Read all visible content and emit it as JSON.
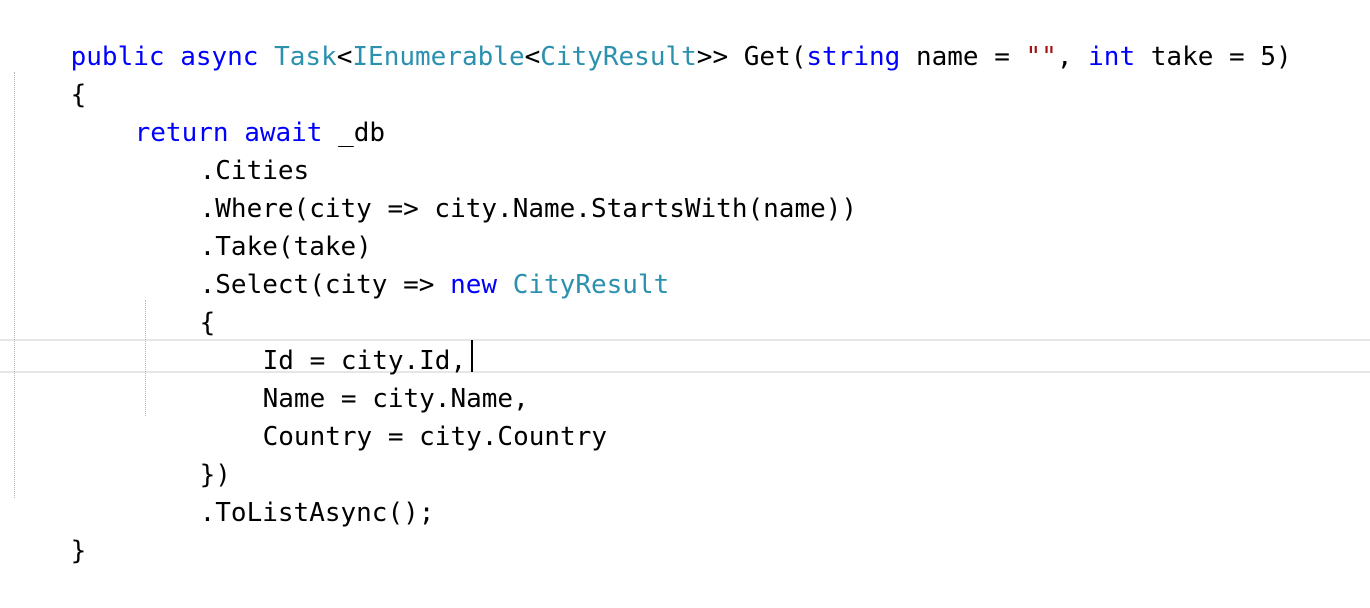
{
  "code": {
    "l1": {
      "t1": "public async ",
      "t2": "Task",
      "t3": "<",
      "t4": "IEnumerable",
      "t5": "<",
      "t6": "CityResult",
      "t7": ">> Get(",
      "t8": "string",
      "t9": " name = ",
      "t10": "\"\"",
      "t11": ", ",
      "t12": "int",
      "t13": " take = 5)"
    },
    "l2": "{",
    "l3": {
      "t1": "return await",
      "t2": " _db"
    },
    "l4": ".Cities",
    "l5": ".Where(city => city.Name.StartsWith(name))",
    "l6": ".Take(take)",
    "l7": {
      "t1": ".Select(city => ",
      "t2": "new",
      "t3": " ",
      "t4": "CityResult"
    },
    "l8": "{",
    "l9": "Id = city.Id,",
    "l10": "Name = city.Name,",
    "l11": "Country = city.Country",
    "l12": "})",
    "l13": ".ToListAsync();",
    "l14": "}"
  },
  "colors": {
    "keyword": "#0000ff",
    "type": "#2b91af",
    "string": "#a31515",
    "text": "#000000",
    "current_line_border": "#e6e6e6"
  }
}
